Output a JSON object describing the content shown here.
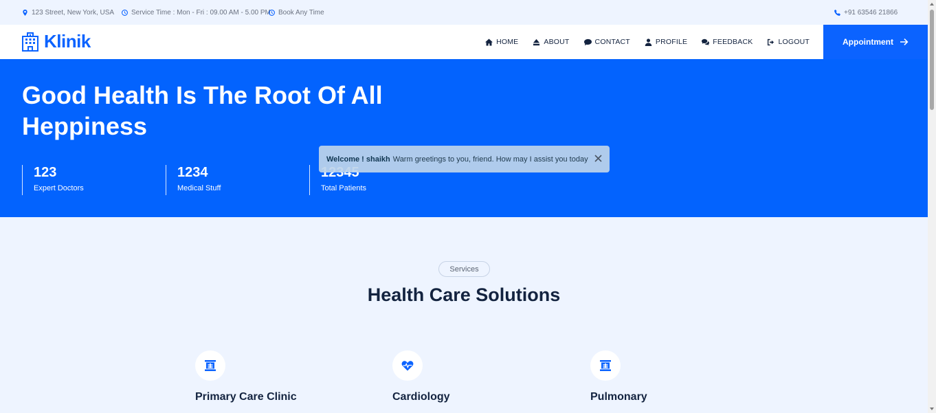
{
  "topbar": {
    "address": "123 Street, New York, USA",
    "service_time": "Service Time : Mon - Fri : 09.00 AM - 5.00 PM",
    "book": "Book Any Time",
    "phone": "+91 63546 21866"
  },
  "brand": {
    "name": "Klinik",
    "icon": "hospital-icon",
    "color": "#0b63ff"
  },
  "nav": {
    "items": [
      {
        "label": "HOME",
        "icon": "home-icon"
      },
      {
        "label": "ABOUT",
        "icon": "eject-icon"
      },
      {
        "label": "CONTACT",
        "icon": "comment-icon"
      },
      {
        "label": "PROFILE",
        "icon": "user-icon"
      },
      {
        "label": "FEEDBACK",
        "icon": "comments-icon"
      },
      {
        "label": "LOGOUT",
        "icon": "sign-out-icon"
      }
    ],
    "appointment_label": "Appointment"
  },
  "hero": {
    "title": "Good Health Is The Root Of All Heppiness",
    "stats": [
      {
        "value": "123",
        "label": "Expert Doctors"
      },
      {
        "value": "1234",
        "label": "Medical Stuff"
      },
      {
        "value": "12345",
        "label": "Total Patients"
      }
    ]
  },
  "toast": {
    "greeting": "Welcome ! shaikh",
    "message": "Warm greetings to you, friend. How may I assist you today"
  },
  "services": {
    "pill": "Services",
    "title": "Health Care Solutions",
    "items": [
      {
        "title": "Primary Care Clinic",
        "icon": "x-ray-icon"
      },
      {
        "title": "Cardiology",
        "icon": "heartbeat-icon"
      },
      {
        "title": "Pulmonary",
        "icon": "x-ray-icon"
      }
    ]
  },
  "colors": {
    "primary": "#0b63ff",
    "hero_bg": "#0363fe",
    "page_bg": "#eef4ff",
    "dark_text": "#13233f"
  }
}
